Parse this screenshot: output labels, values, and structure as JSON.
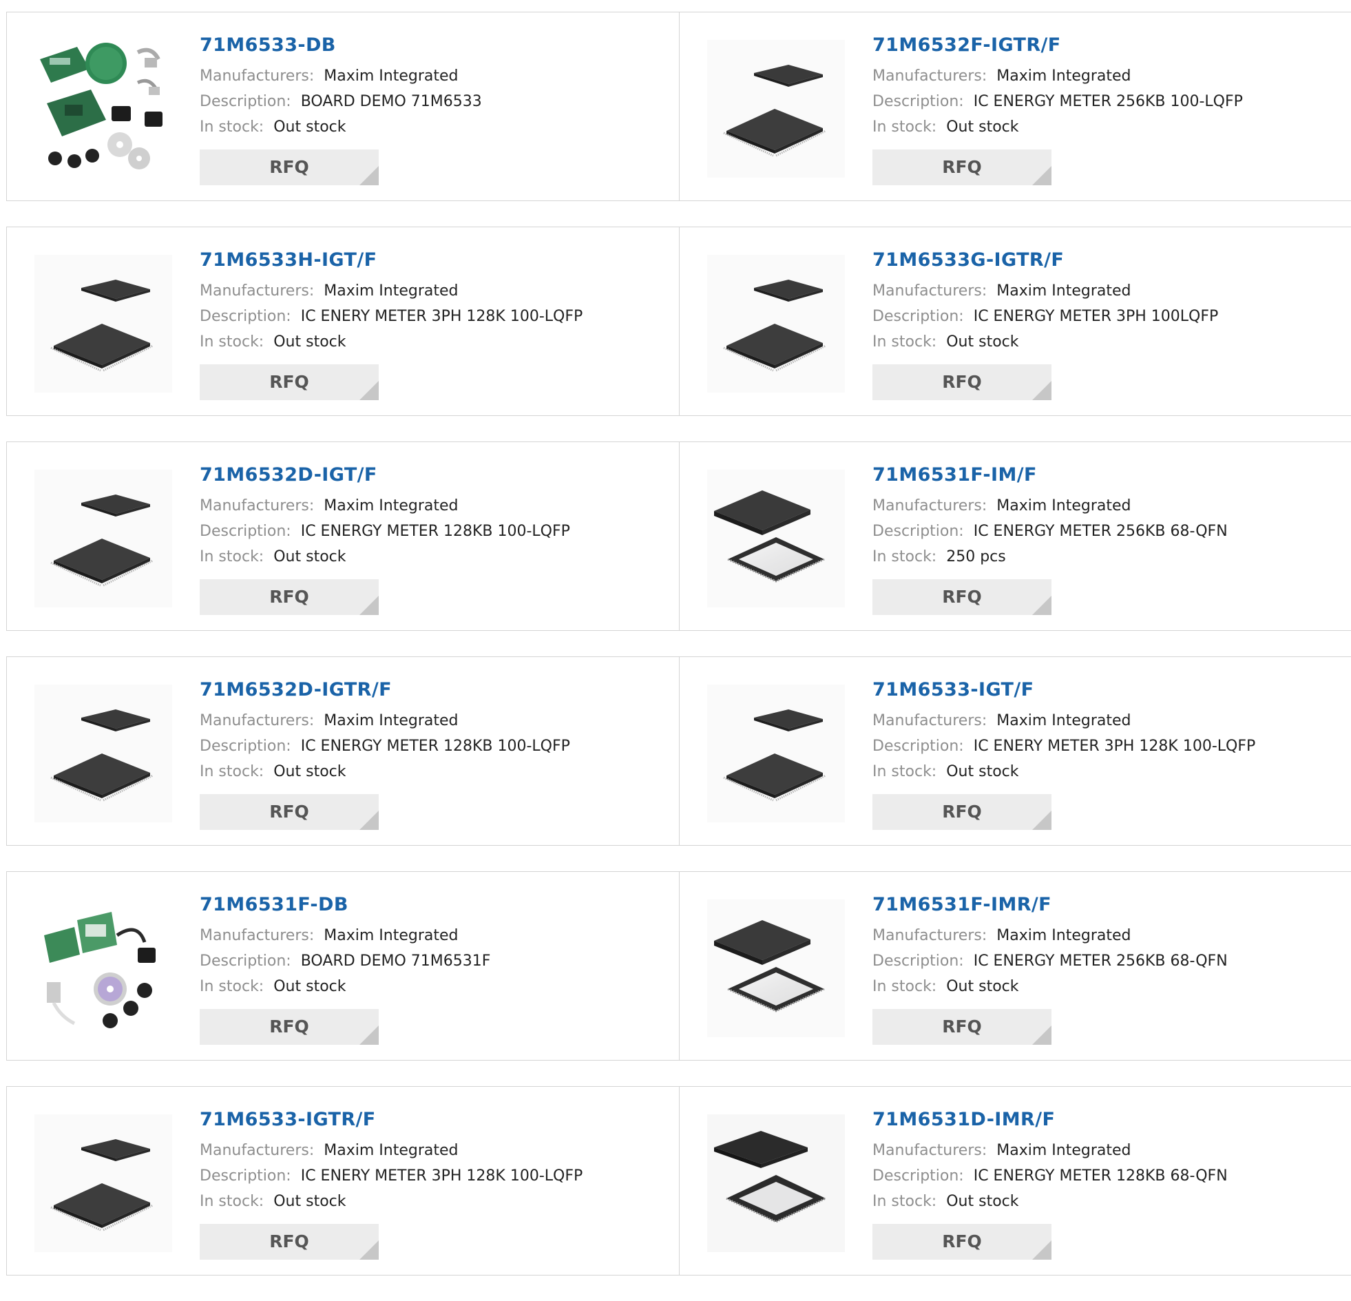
{
  "labels": {
    "manufacturers": "Manufacturers:",
    "description": "Description:",
    "stock": "In stock:",
    "rfq": "RFQ"
  },
  "products": [
    {
      "part": "71M6533-DB",
      "manufacturer": "Maxim Integrated",
      "description": "BOARD DEMO 71M6533",
      "stock": "Out stock",
      "image": "demo-board-kit"
    },
    {
      "part": "71M6532F-IGTR/F",
      "manufacturer": "Maxim Integrated",
      "description": "IC ENERGY METER 256KB 100-LQFP",
      "stock": "Out stock",
      "image": "lqfp-chip"
    },
    {
      "part": "71M6533H-IGT/F",
      "manufacturer": "Maxim Integrated",
      "description": "IC ENERY METER 3PH 128K 100-LQFP",
      "stock": "Out stock",
      "image": "lqfp-chip"
    },
    {
      "part": "71M6533G-IGTR/F",
      "manufacturer": "Maxim Integrated",
      "description": "IC ENERGY METER 3PH 100LQFP",
      "stock": "Out stock",
      "image": "lqfp-chip"
    },
    {
      "part": "71M6532D-IGT/F",
      "manufacturer": "Maxim Integrated",
      "description": "IC ENERGY METER 128KB 100-LQFP",
      "stock": "Out stock",
      "image": "lqfp-chip"
    },
    {
      "part": "71M6531F-IM/F",
      "manufacturer": "Maxim Integrated",
      "description": "IC ENERGY METER 256KB 68-QFN",
      "stock": "250 pcs",
      "image": "qfn-chip"
    },
    {
      "part": "71M6532D-IGTR/F",
      "manufacturer": "Maxim Integrated",
      "description": "IC ENERGY METER 128KB 100-LQFP",
      "stock": "Out stock",
      "image": "lqfp-chip"
    },
    {
      "part": "71M6533-IGT/F",
      "manufacturer": "Maxim Integrated",
      "description": "IC ENERY METER 3PH 128K 100-LQFP",
      "stock": "Out stock",
      "image": "lqfp-chip"
    },
    {
      "part": "71M6531F-DB",
      "manufacturer": "Maxim Integrated",
      "description": "BOARD DEMO 71M6531F",
      "stock": "Out stock",
      "image": "demo-board-kit-2"
    },
    {
      "part": "71M6531F-IMR/F",
      "manufacturer": "Maxim Integrated",
      "description": "IC ENERGY METER 256KB 68-QFN",
      "stock": "Out stock",
      "image": "qfn-chip"
    },
    {
      "part": "71M6533-IGTR/F",
      "manufacturer": "Maxim Integrated",
      "description": "IC ENERY METER 3PH 128K 100-LQFP",
      "stock": "Out stock",
      "image": "lqfp-chip"
    },
    {
      "part": "71M6531D-IMR/F",
      "manufacturer": "Maxim Integrated",
      "description": "IC ENERGY METER 128KB 68-QFN",
      "stock": "Out stock",
      "image": "qfn-chip-dark"
    }
  ],
  "colors": {
    "part_link": "#1a63a8",
    "label": "#8e8e8e",
    "value": "#222222",
    "rfq_bg": "#ececec",
    "border": "#d4d4d4"
  }
}
